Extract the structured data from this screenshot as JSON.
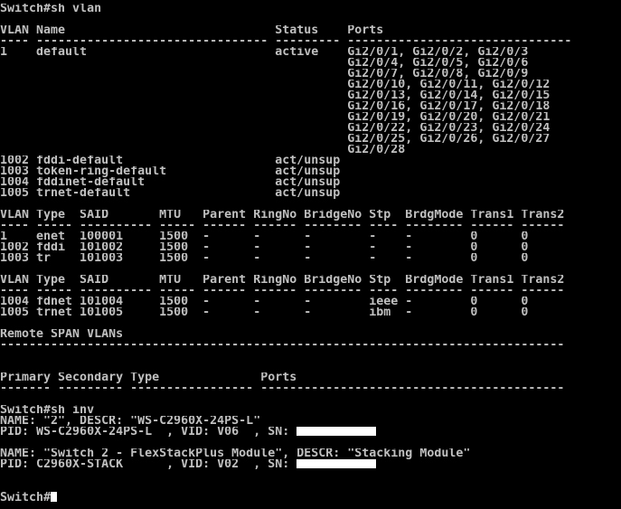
{
  "colors": {
    "background": "#000000",
    "text": "#c0c0c0",
    "redaction": "#ffffff",
    "cursor": "#ffffff"
  },
  "lines": [
    "Switch#sh vlan",
    "",
    "VLAN Name                             Status    Ports",
    "---- -------------------------------- --------- -------------------------------",
    "1    default                          active    Gi2/0/1, Gi2/0/2, Gi2/0/3",
    "                                                Gi2/0/4, Gi2/0/5, Gi2/0/6",
    "                                                Gi2/0/7, Gi2/0/8, Gi2/0/9",
    "                                                Gi2/0/10, Gi2/0/11, Gi2/0/12",
    "                                                Gi2/0/13, Gi2/0/14, Gi2/0/15",
    "                                                Gi2/0/16, Gi2/0/17, Gi2/0/18",
    "                                                Gi2/0/19, Gi2/0/20, Gi2/0/21",
    "                                                Gi2/0/22, Gi2/0/23, Gi2/0/24",
    "                                                Gi2/0/25, Gi2/0/26, Gi2/0/27",
    "                                                Gi2/0/28",
    "1002 fddi-default                     act/unsup",
    "1003 token-ring-default               act/unsup",
    "1004 fddinet-default                  act/unsup",
    "1005 trnet-default                    act/unsup",
    "",
    "VLAN Type  SAID       MTU   Parent RingNo BridgeNo Stp  BrdgMode Trans1 Trans2",
    "---- ----- ---------- ----- ------ ------ -------- ---- -------- ------ ------",
    "1    enet  100001     1500  -      -      -        -    -        0      0",
    "1002 fddi  101002     1500  -      -      -        -    -        0      0",
    "1003 tr    101003     1500  -      -      -        -    -        0      0",
    "",
    "VLAN Type  SAID       MTU   Parent RingNo BridgeNo Stp  BrdgMode Trans1 Trans2",
    "---- ----- ---------- ----- ------ ------ -------- ---- -------- ------ ------",
    "1004 fdnet 101004     1500  -      -      -        ieee -        0      0",
    "1005 trnet 101005     1500  -      -      -        ibm  -        0      0",
    "",
    "Remote SPAN VLANs",
    "------------------------------------------------------------------------------",
    "",
    "",
    "Primary Secondary Type              Ports",
    "------- --------- ----------------- ------------------------------------------",
    "",
    "Switch#sh inv",
    "NAME: \"2\", DESCR: \"WS-C2960X-24PS-L\"",
    "PID: WS-C2960X-24PS-L  , VID: V06  , SN: ",
    "",
    "NAME: \"Switch 2 - FlexStackPlus Module\", DESCR: \"Stacking Module\"",
    "PID: C2960X-STACK      , VID: V02  , SN: ",
    "",
    "",
    "Switch#"
  ]
}
